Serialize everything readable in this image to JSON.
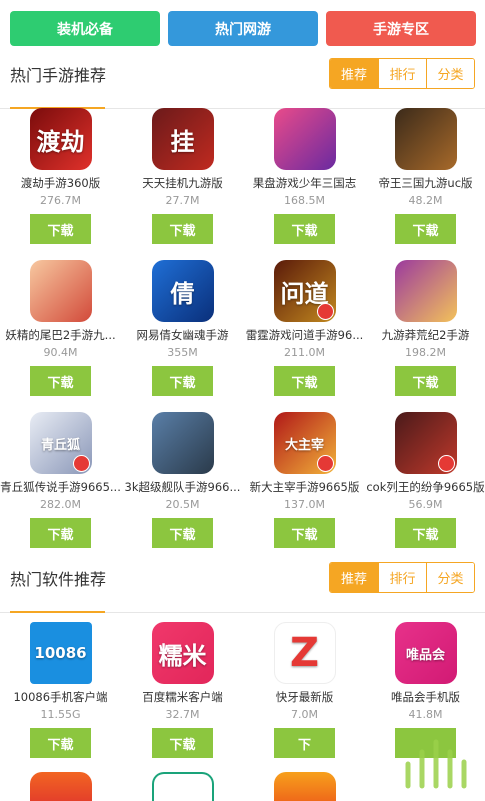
{
  "topbar": {
    "buttons": [
      {
        "label": "装机必备",
        "color": "#2ecc71"
      },
      {
        "label": "热门网游",
        "color": "#3498db"
      },
      {
        "label": "手游专区",
        "color": "#f05a4f"
      }
    ]
  },
  "tabs": {
    "recommend": "推荐",
    "rank": "排行",
    "category": "分类"
  },
  "sections": [
    {
      "title": "热门手游推荐",
      "items": [
        {
          "name": "渡劫手游360版",
          "size": "276.7M",
          "download": "下载",
          "icon": "dujie-icon",
          "icon_text": "渡劫",
          "colors": [
            "#7a0c0c",
            "#e0312b"
          ]
        },
        {
          "name": "天天挂机九游版",
          "size": "27.7M",
          "download": "下载",
          "icon": "guaji-icon",
          "icon_text": "挂",
          "colors": [
            "#6b1a1a",
            "#c02a20"
          ]
        },
        {
          "name": "果盘游戏少年三国志",
          "size": "168.5M",
          "download": "下载",
          "icon": "sanguozhi-icon",
          "icon_text": "",
          "colors": [
            "#e94b8a",
            "#6a2aa0"
          ]
        },
        {
          "name": "帝王三国九游uc版",
          "size": "48.2M",
          "download": "下载",
          "icon": "diwang-icon",
          "icon_text": "",
          "colors": [
            "#3b2a1a",
            "#a86a2a"
          ]
        },
        {
          "name": "妖精的尾巴2手游九...",
          "size": "90.4M",
          "download": "下载",
          "icon": "yaojing-icon",
          "icon_text": "",
          "colors": [
            "#f7c8a0",
            "#d24a3a"
          ]
        },
        {
          "name": "网易倩女幽魂手游",
          "size": "355M",
          "download": "下载",
          "icon": "qiannv-icon",
          "icon_text": "倩",
          "colors": [
            "#1f6fd6",
            "#0a2f7a"
          ]
        },
        {
          "name": "雷霆游戏问道手游96...",
          "size": "211.0M",
          "download": "下载",
          "icon": "wendao-icon",
          "icon_text": "问道",
          "colors": [
            "#5a1a0a",
            "#c2891f"
          ]
        },
        {
          "name": "九游莽荒纪2手游",
          "size": "198.2M",
          "download": "下载",
          "icon": "manghuang-icon",
          "icon_text": "",
          "colors": [
            "#9b3a9e",
            "#f3c25a"
          ]
        },
        {
          "name": "青丘狐传说手游9665...",
          "size": "282.0M",
          "download": "下载",
          "icon": "qingqiu-icon",
          "icon_text": "青丘狐",
          "colors": [
            "#e8ecf4",
            "#8a97b8"
          ]
        },
        {
          "name": "3k超级舰队手游966...",
          "size": "20.5M",
          "download": "下载",
          "icon": "jiandui-icon",
          "icon_text": "",
          "colors": [
            "#5a7fa8",
            "#2a3a4a"
          ]
        },
        {
          "name": "新大主宰手游9665版",
          "size": "137.0M",
          "download": "下载",
          "icon": "zhuzai-icon",
          "icon_text": "大主宰",
          "colors": [
            "#b01818",
            "#f2b33a"
          ]
        },
        {
          "name": "cok列王的纷争9665版",
          "size": "56.9M",
          "download": "下载",
          "icon": "cok-icon",
          "icon_text": "",
          "colors": [
            "#4a1a1a",
            "#c0392b"
          ]
        }
      ]
    },
    {
      "title": "热门软件推荐",
      "items": [
        {
          "name": "10086手机客户端",
          "size": "11.55G",
          "download": "下载",
          "icon": "10086-icon",
          "icon_text": "10086",
          "colors": [
            "#1a8fe0",
            "#1a8fe0"
          ]
        },
        {
          "name": "百度糯米客户端",
          "size": "32.7M",
          "download": "下载",
          "icon": "nuomi-icon",
          "icon_text": "糯米",
          "colors": [
            "#f0386b",
            "#e2265a"
          ]
        },
        {
          "name": "快牙最新版",
          "size": "7.0M",
          "download": "下",
          "icon": "kuaiya-icon",
          "icon_text": "Z",
          "colors": [
            "#ffffff",
            "#ffffff"
          ]
        },
        {
          "name": "唯品会手机版",
          "size": "41.8M",
          "download": "",
          "icon": "vip-icon",
          "icon_text": "唯品会",
          "colors": [
            "#e7318a",
            "#d21a74"
          ]
        }
      ]
    }
  ]
}
